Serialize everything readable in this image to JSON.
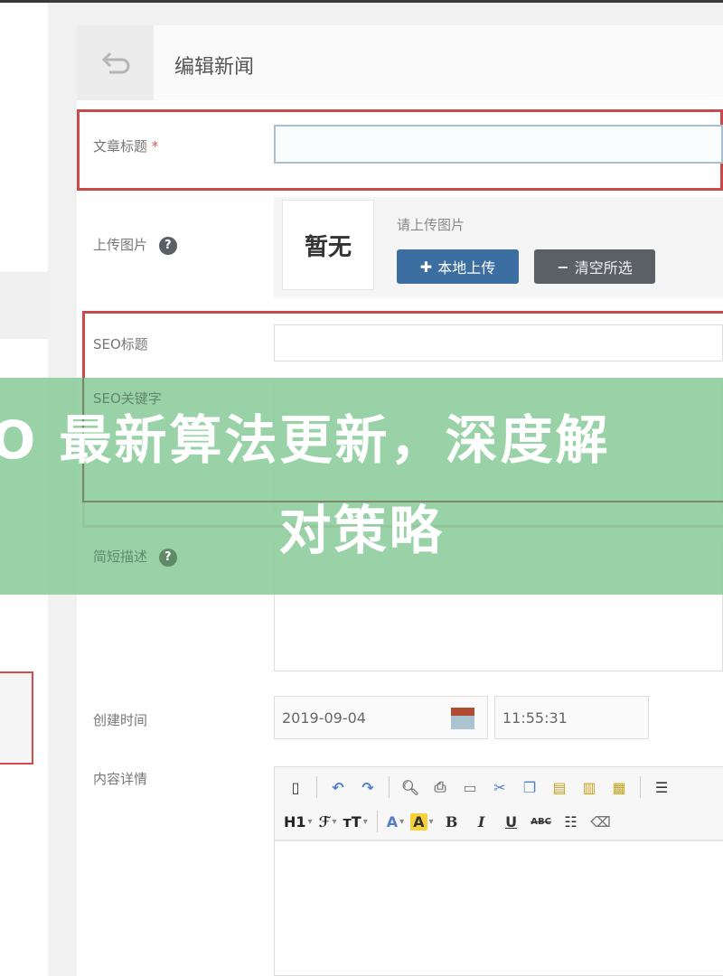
{
  "header": {
    "back_icon": "back-arrow-icon",
    "title": "编辑新闻"
  },
  "form": {
    "title_field": {
      "label": "文章标题",
      "required_mark": "*",
      "value": ""
    },
    "image_field": {
      "label": "上传图片",
      "help_icon": "question-icon",
      "preview_text": "暂无",
      "hint": "请上传图片",
      "upload_button": "本地上传",
      "upload_icon": "plus-icon",
      "clear_button": "清空所选",
      "clear_icon": "minus-icon"
    },
    "seo_title": {
      "label": "SEO标题",
      "value": ""
    },
    "seo_keywords": {
      "label": "SEO关键字",
      "value": ""
    },
    "description": {
      "label": "简短描述",
      "help_icon": "question-icon",
      "value": ""
    },
    "created_time": {
      "label": "创建时间",
      "date": "2019-09-04",
      "time": "11:55:31",
      "calendar_icon": "calendar-icon"
    },
    "content": {
      "label": "内容详情",
      "value": ""
    }
  },
  "editor_toolbar": {
    "row1": [
      "source-icon",
      "undo-icon",
      "redo-icon",
      "preview-icon",
      "print-icon",
      "template-icon",
      "cut-icon",
      "copy-icon",
      "paste-icon",
      "paste-text-icon",
      "paste-word-icon",
      "align-icon"
    ],
    "row2": {
      "heading": "H1",
      "font_family": "ℱ",
      "font_size": "ᴛT",
      "font_color": "A",
      "bg_color": "A",
      "bold": "B",
      "italic": "I",
      "underline": "U",
      "strikethrough": "ABC",
      "table": "☷",
      "eraser": "⌫"
    }
  },
  "banner": {
    "line1": "O 最新算法更新，深度解",
    "line2": "对策略"
  },
  "colors": {
    "highlight_border": "#c94a4a",
    "primary_button": "#3c6ea1",
    "secondary_button": "#5b5f66",
    "banner_green": "#91cfa0"
  }
}
